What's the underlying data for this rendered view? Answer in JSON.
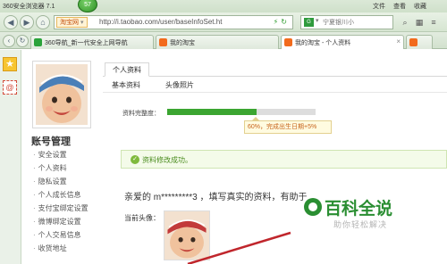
{
  "window": {
    "app_title": "360安全浏览器 7.1",
    "badge_count": "57",
    "menu": [
      "文件",
      "查看",
      "收藏"
    ]
  },
  "address_bar": {
    "site_id_label": "淘宝网",
    "url": "http://i.taobao.com/user/baseInfoSet.ht",
    "search_engine_label": "G",
    "search_placeholder": "宁夏银川小"
  },
  "tabs": [
    {
      "label": "360导航_新一代安全上网导航",
      "active": false
    },
    {
      "label": "我的淘宝",
      "active": false
    },
    {
      "label": "我的淘宝 - 个人资料",
      "active": true
    }
  ],
  "sidebar": {
    "heading": "账号管理",
    "items": [
      "安全设置",
      "个人资料",
      "隐私设置",
      "个人成长信息",
      "支付宝绑定设置",
      "微博绑定设置",
      "个人交易信息",
      "收货地址"
    ]
  },
  "main": {
    "primary_tab": "个人资料",
    "sub_tabs": [
      "基本资料",
      "头像照片"
    ],
    "progress_label": "资料完整度：",
    "progress_percent": 60,
    "progress_tip": "60%，完成出生日期+5%",
    "success_message": "资料修改成功。",
    "greeting": "亲爱的 m*********3 ，填写真实的资料，有助于",
    "current_avatar_label": "当前头像："
  },
  "watermark": {
    "main": "百科全说",
    "sub": "助你轻松解决"
  },
  "colors": {
    "progress_fill": "#3ba531",
    "success_text": "#4a8c1e",
    "watermark_green": "#2a8e32"
  }
}
